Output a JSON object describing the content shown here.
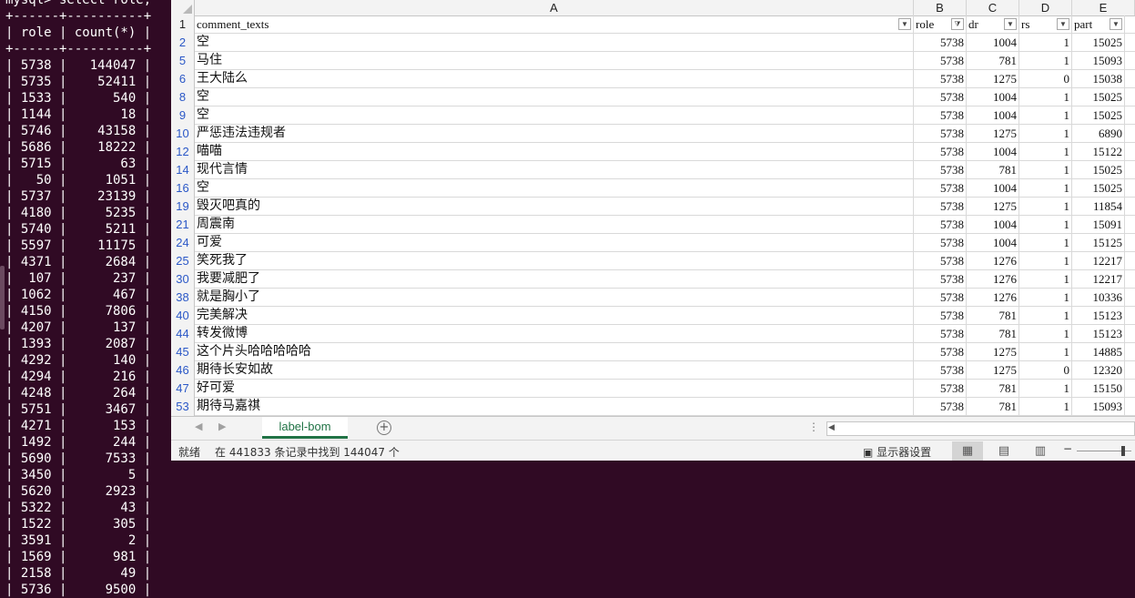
{
  "terminal": {
    "prompt": "mysql> select role,",
    "border": "+------+----------+",
    "header_role": "role",
    "header_count": "count(*)",
    "rows": [
      [
        "5738",
        "144047"
      ],
      [
        "5735",
        "52411"
      ],
      [
        "1533",
        "540"
      ],
      [
        "1144",
        "18"
      ],
      [
        "5746",
        "43158"
      ],
      [
        "5686",
        "18222"
      ],
      [
        "5715",
        "63"
      ],
      [
        "50",
        "1051"
      ],
      [
        "5737",
        "23139"
      ],
      [
        "4180",
        "5235"
      ],
      [
        "5740",
        "5211"
      ],
      [
        "5597",
        "11175"
      ],
      [
        "4371",
        "2684"
      ],
      [
        "107",
        "237"
      ],
      [
        "1062",
        "467"
      ],
      [
        "4150",
        "7806"
      ],
      [
        "4207",
        "137"
      ],
      [
        "1393",
        "2087"
      ],
      [
        "4292",
        "140"
      ],
      [
        "4294",
        "216"
      ],
      [
        "4248",
        "264"
      ],
      [
        "5751",
        "3467"
      ],
      [
        "4271",
        "153"
      ],
      [
        "1492",
        "244"
      ],
      [
        "5690",
        "7533"
      ],
      [
        "3450",
        "5"
      ],
      [
        "5620",
        "2923"
      ],
      [
        "5322",
        "43"
      ],
      [
        "1522",
        "305"
      ],
      [
        "3591",
        "2"
      ],
      [
        "1569",
        "981"
      ],
      [
        "2158",
        "49"
      ],
      [
        "5736",
        "9500"
      ]
    ]
  },
  "spreadsheet": {
    "columns": [
      "A",
      "B",
      "C",
      "D",
      "E"
    ],
    "header_row_number": "1",
    "headers": [
      "comment_texts",
      "role",
      "dr",
      "rs",
      "part"
    ],
    "filtered_column": "role",
    "rows": [
      {
        "n": "2",
        "text": "空",
        "role": "5738",
        "dr": "1004",
        "rs": "1",
        "part": "15025"
      },
      {
        "n": "5",
        "text": "马住",
        "role": "5738",
        "dr": "781",
        "rs": "1",
        "part": "15093"
      },
      {
        "n": "6",
        "text": "王大陆么",
        "role": "5738",
        "dr": "1275",
        "rs": "0",
        "part": "15038"
      },
      {
        "n": "8",
        "text": "空",
        "role": "5738",
        "dr": "1004",
        "rs": "1",
        "part": "15025"
      },
      {
        "n": "9",
        "text": "空",
        "role": "5738",
        "dr": "1004",
        "rs": "1",
        "part": "15025"
      },
      {
        "n": "10",
        "text": "严惩违法违规者",
        "role": "5738",
        "dr": "1275",
        "rs": "1",
        "part": "6890"
      },
      {
        "n": "12",
        "text": "喵喵",
        "role": "5738",
        "dr": "1004",
        "rs": "1",
        "part": "15122"
      },
      {
        "n": "14",
        "text": "现代言情",
        "role": "5738",
        "dr": "781",
        "rs": "1",
        "part": "15025"
      },
      {
        "n": "16",
        "text": "空",
        "role": "5738",
        "dr": "1004",
        "rs": "1",
        "part": "15025"
      },
      {
        "n": "19",
        "text": "毁灭吧真的",
        "role": "5738",
        "dr": "1275",
        "rs": "1",
        "part": "11854"
      },
      {
        "n": "21",
        "text": "周震南",
        "role": "5738",
        "dr": "1004",
        "rs": "1",
        "part": "15091"
      },
      {
        "n": "24",
        "text": "可爱",
        "role": "5738",
        "dr": "1004",
        "rs": "1",
        "part": "15125"
      },
      {
        "n": "25",
        "text": "笑死我了",
        "role": "5738",
        "dr": "1276",
        "rs": "1",
        "part": "12217"
      },
      {
        "n": "30",
        "text": "我要减肥了",
        "role": "5738",
        "dr": "1276",
        "rs": "1",
        "part": "12217"
      },
      {
        "n": "38",
        "text": "就是胸小了",
        "role": "5738",
        "dr": "1276",
        "rs": "1",
        "part": "10336"
      },
      {
        "n": "40",
        "text": "完美解决",
        "role": "5738",
        "dr": "781",
        "rs": "1",
        "part": "15123"
      },
      {
        "n": "44",
        "text": "转发微博",
        "role": "5738",
        "dr": "781",
        "rs": "1",
        "part": "15123"
      },
      {
        "n": "45",
        "text": "这个片头哈哈哈哈哈",
        "role": "5738",
        "dr": "1275",
        "rs": "1",
        "part": "14885"
      },
      {
        "n": "46",
        "text": "期待长安如故",
        "role": "5738",
        "dr": "1275",
        "rs": "0",
        "part": "12320"
      },
      {
        "n": "47",
        "text": "好可爱",
        "role": "5738",
        "dr": "781",
        "rs": "1",
        "part": "15150"
      },
      {
        "n": "53",
        "text": "期待马嘉祺",
        "role": "5738",
        "dr": "781",
        "rs": "1",
        "part": "15093"
      }
    ],
    "sheet_tab": "label-bom",
    "add_sheet": "+",
    "nav_prev": "◀",
    "nav_next": "▶"
  },
  "statusbar": {
    "ready": "就绪",
    "records": "在 441833 条记录中找到 144047 个",
    "display_settings": "显示器设置",
    "zoom_minus": "−"
  },
  "colors": {
    "terminal_bg": "#300a24",
    "accent": "#217346",
    "row_number": "#2b58c7"
  }
}
